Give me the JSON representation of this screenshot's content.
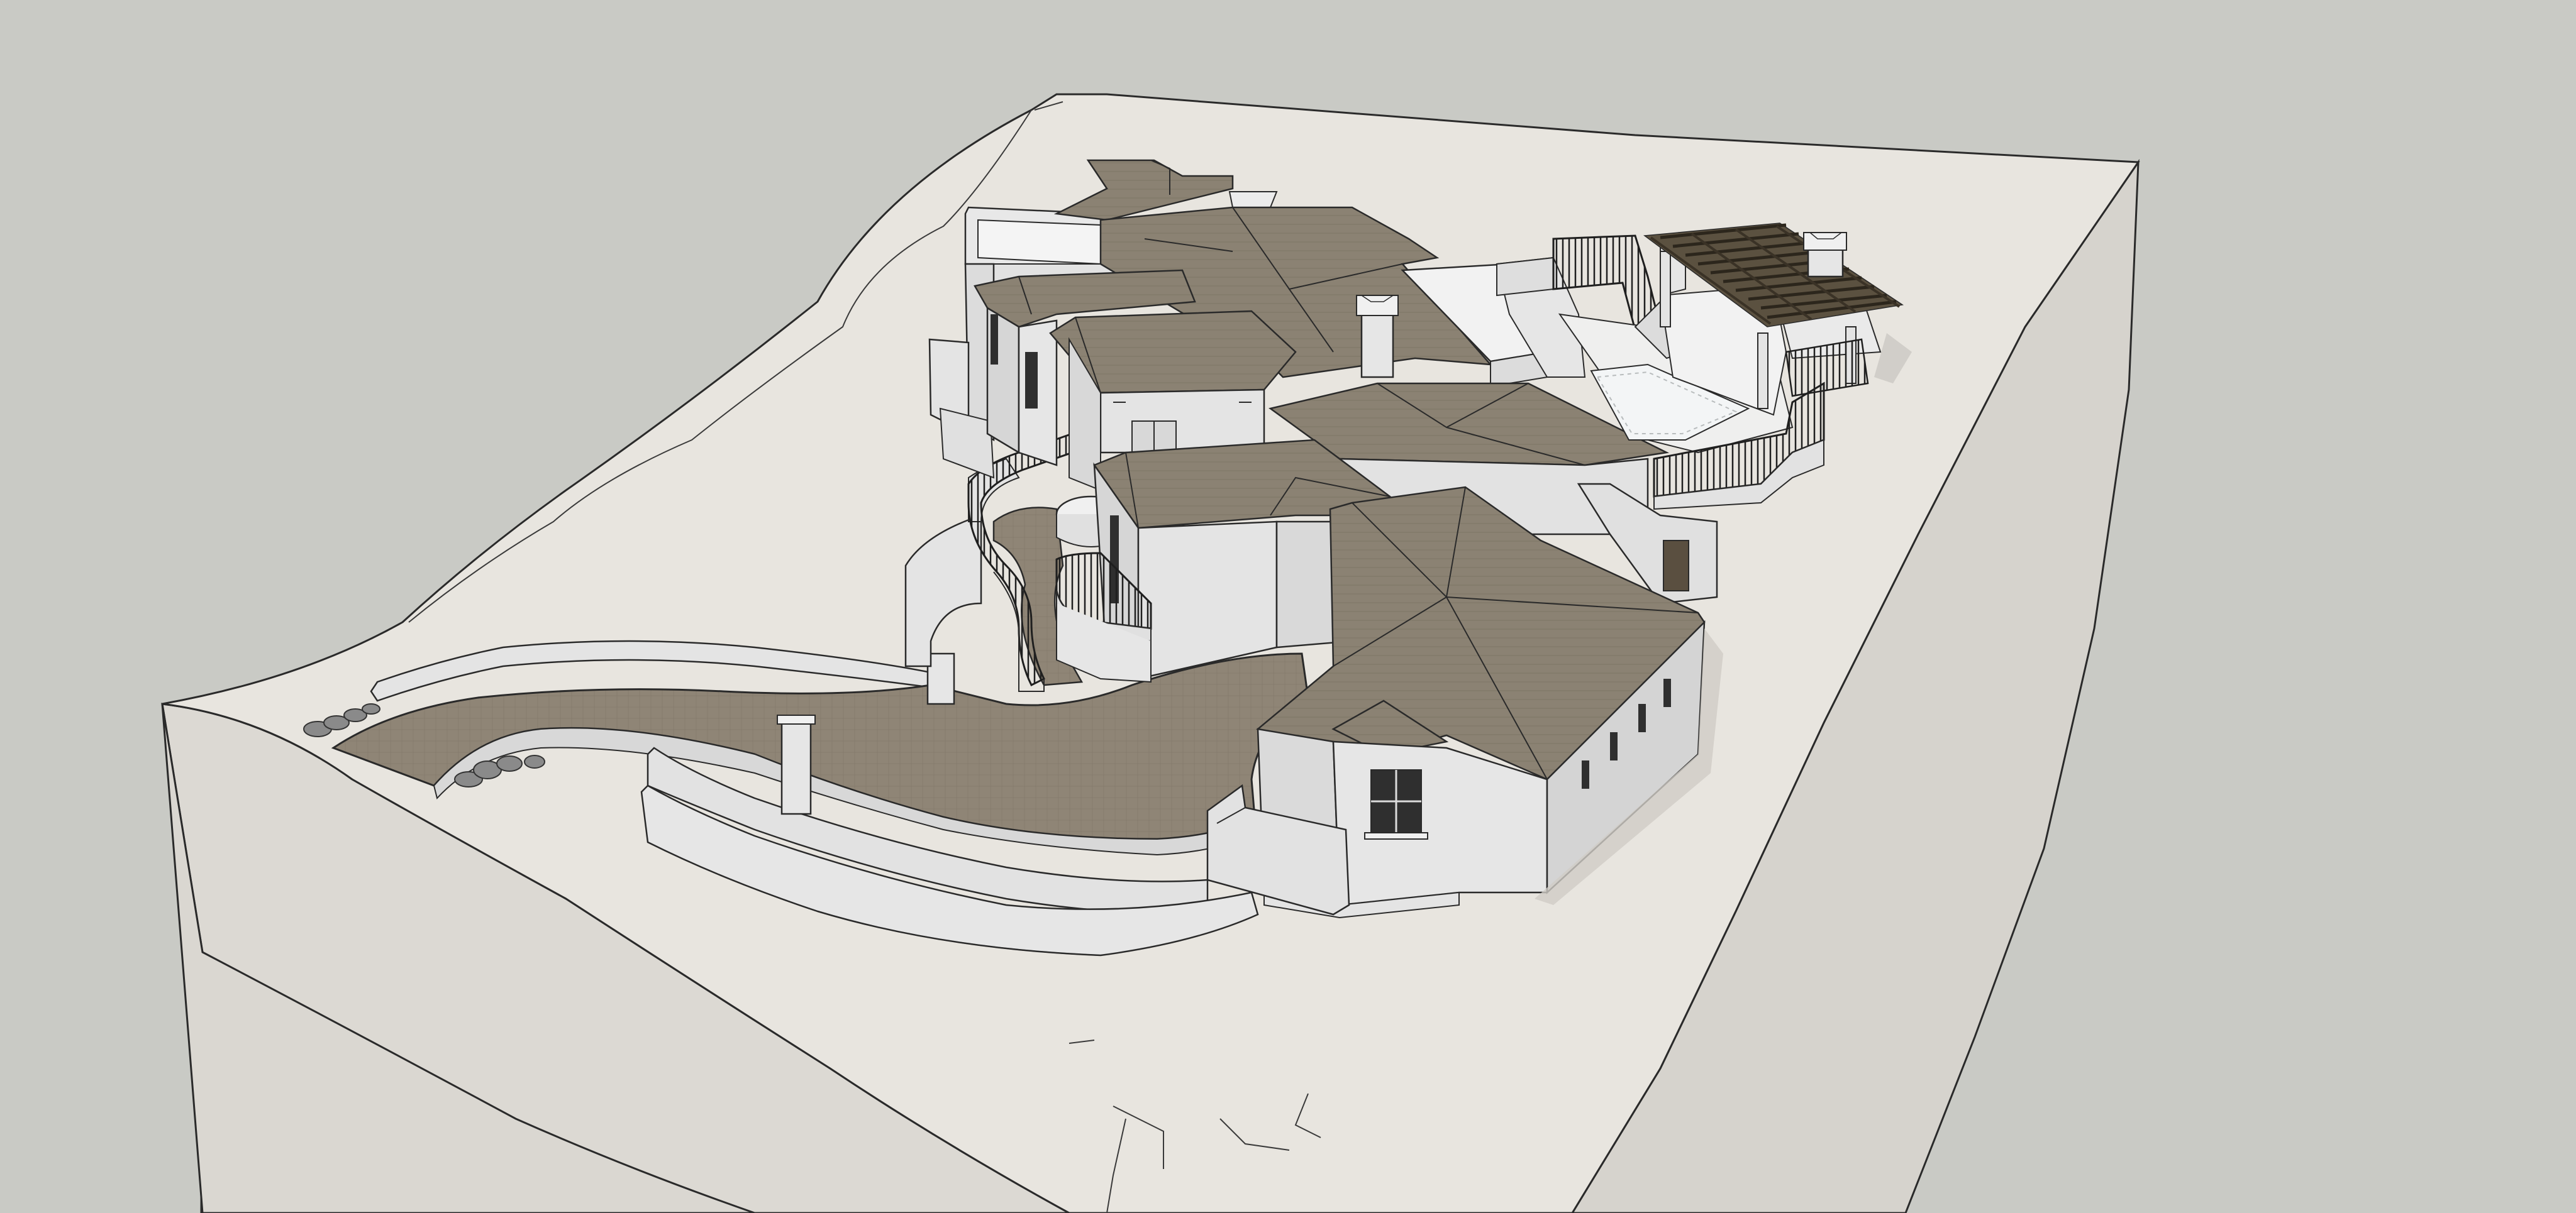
{
  "scene": {
    "view": "3d-perspective",
    "subject": "residential-site-model",
    "colors": {
      "background": "#c9cac5",
      "terrain_top": "#e8e5df",
      "terrain_side": "#dcd9d3",
      "roof": "#8b8273",
      "roof_dark": "#706759",
      "wall": "#e4e4e4",
      "wall_shade": "#d2d2d2",
      "driveway": "#8f8576",
      "pergola": "#4a4234",
      "pool": "#eef0f0",
      "railing": "#1f1f1f",
      "outline": "#2a2a2a"
    }
  }
}
